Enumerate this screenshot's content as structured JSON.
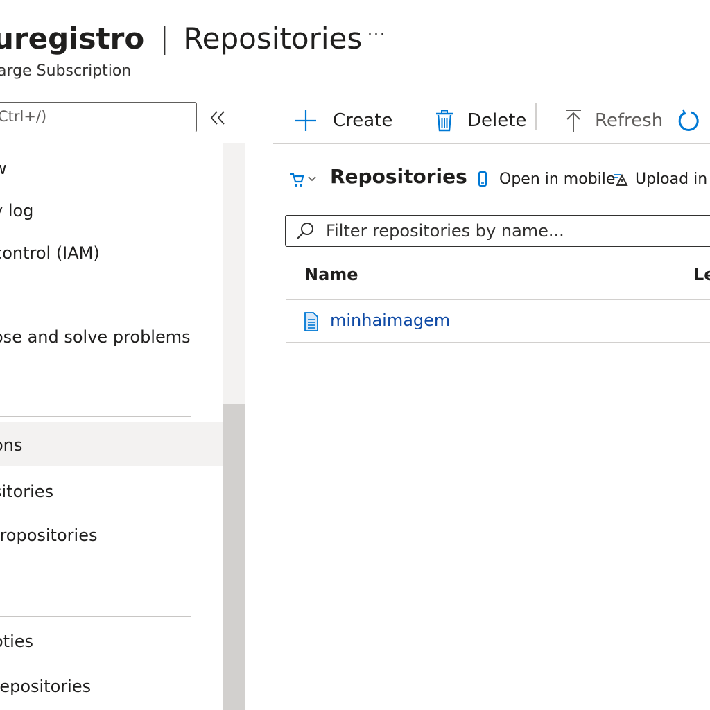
{
  "header": {
    "resource_name": "uregistro",
    "separator": "|",
    "page_title": "Repositories",
    "more_label": "···",
    "subtitle": "arge Subscription"
  },
  "sidebar": {
    "search_placeholder": "Ctrl+/)",
    "collapse_icon": "double-chevron-left-icon",
    "items": [
      {
        "label": "w"
      },
      {
        "label": "y log"
      },
      {
        "label": "control (IAM)"
      },
      {
        "label": "ose and solve problems"
      },
      {
        "label": "ons",
        "selected": true
      },
      {
        "label": "sitories"
      },
      {
        "label": "rropositories"
      },
      {
        "label": "oties"
      },
      {
        "label": "repositories"
      }
    ]
  },
  "toolbar": {
    "create_label": "Create",
    "delete_label": "Delete",
    "refresh_label": "Refresh"
  },
  "content": {
    "heading": "Repositories",
    "open_mobile_label": "Open in mobile",
    "upload_label": "Upload in p",
    "filter_placeholder": "Filter repositories by name...",
    "columns": [
      "Name",
      "Le"
    ],
    "rows": [
      {
        "name": "minhaimagem"
      }
    ]
  },
  "colors": {
    "accent": "#0078d4",
    "link": "#0f4aa5",
    "selected_bg": "#f3f2f1"
  }
}
